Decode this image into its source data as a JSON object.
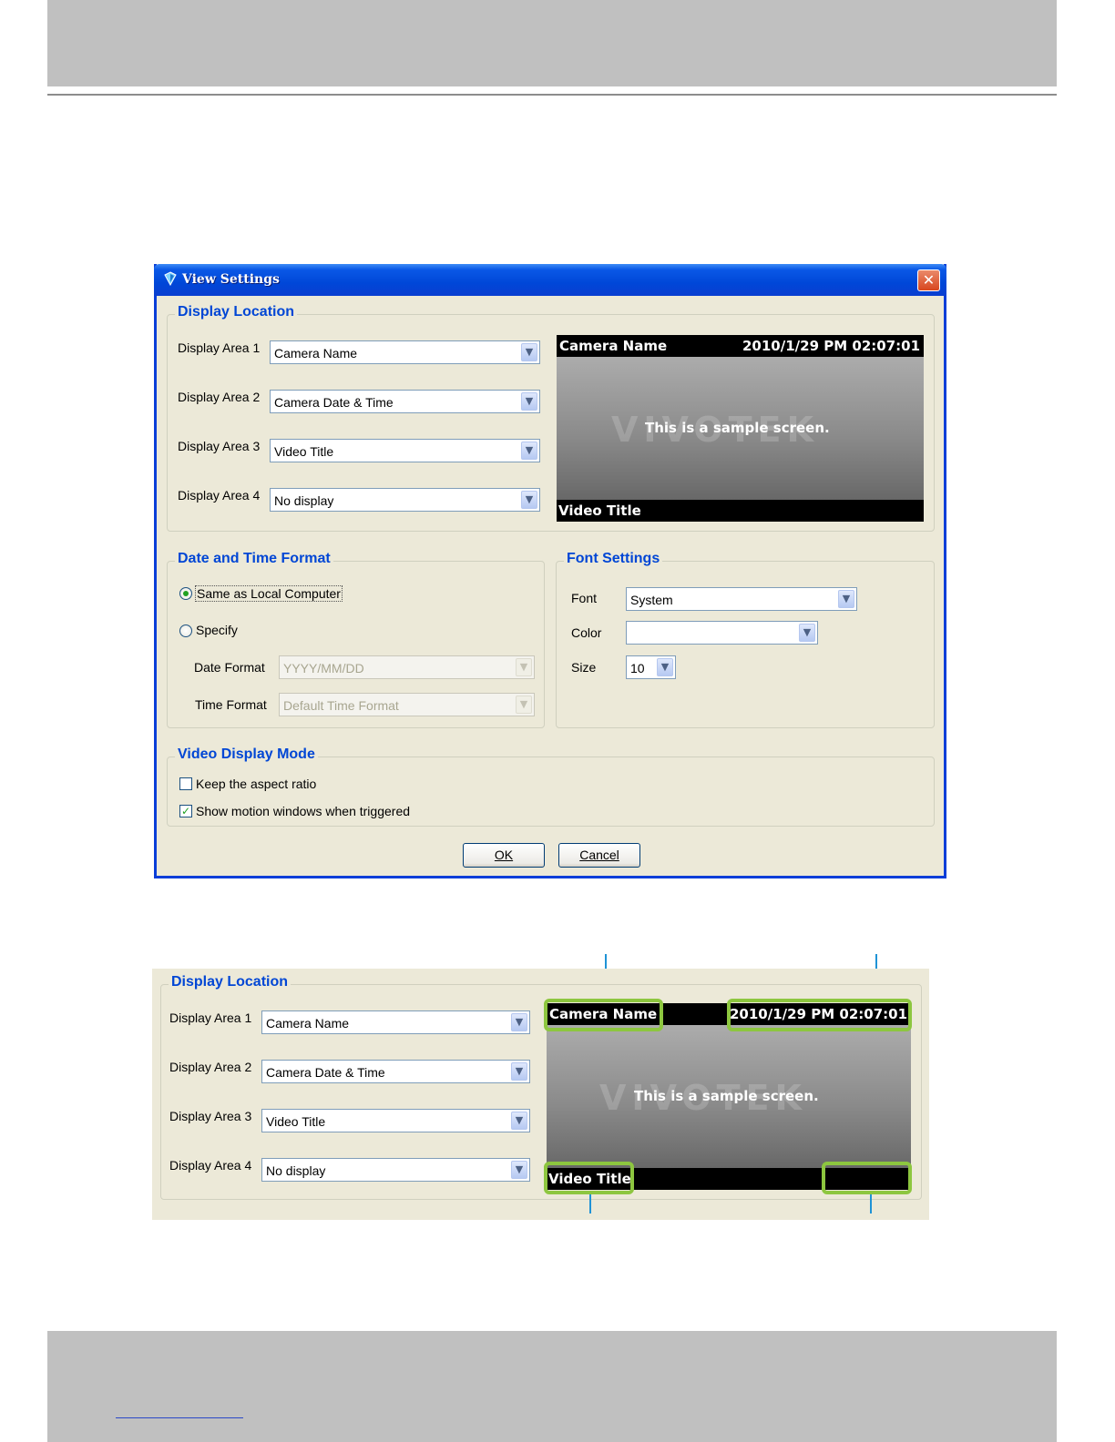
{
  "dialog": {
    "title": "View Settings",
    "close_glyph": "✕",
    "display_location": {
      "title": "Display Location",
      "areas": [
        {
          "label": "Display Area 1",
          "value": "Camera Name"
        },
        {
          "label": "Display Area 2",
          "value": "Camera Date & Time"
        },
        {
          "label": "Display Area 3",
          "value": "Video Title"
        },
        {
          "label": "Display Area 4",
          "value": "No display"
        }
      ],
      "preview": {
        "camera_name": "Camera Name",
        "datetime": "2010/1/29 PM 02:07:01",
        "sample_text": "This is a sample screen.",
        "logo": "VIVOTEK",
        "video_title": "Video Title"
      }
    },
    "date_time_format": {
      "title": "Date and Time Format",
      "option_local": "Same as Local Computer",
      "option_specify": "Specify",
      "date_format_label": "Date Format",
      "date_format_value": "YYYY/MM/DD",
      "time_format_label": "Time Format",
      "time_format_value": "Default Time Format"
    },
    "font_settings": {
      "title": "Font Settings",
      "font_label": "Font",
      "font_value": "System",
      "color_label": "Color",
      "color_value": "",
      "size_label": "Size",
      "size_value": "10"
    },
    "video_display_mode": {
      "title": "Video Display Mode",
      "keep_aspect": "Keep the aspect ratio",
      "keep_aspect_checked": false,
      "show_motion": "Show motion windows when triggered",
      "show_motion_checked": true
    },
    "ok_label": "OK",
    "cancel_label": "Cancel"
  },
  "detail_panel": {
    "title": "Display Location",
    "areas": [
      {
        "label": "Display Area 1",
        "value": "Camera Name"
      },
      {
        "label": "Display Area 2",
        "value": "Camera Date & Time"
      },
      {
        "label": "Display Area 3",
        "value": "Video Title"
      },
      {
        "label": "Display Area 4",
        "value": "No display"
      }
    ],
    "preview": {
      "camera_name": "Camera Name",
      "datetime": "2010/1/29 PM 02:07:01",
      "sample_text": "This is a sample screen.",
      "logo": "VIVOTEK",
      "video_title": "Video Title"
    }
  },
  "colors": {
    "highlight": "#8dc63f",
    "callout": "#1f93d6",
    "group_title": "#0046d5"
  },
  "icons": {
    "combo_arrow": "▼",
    "check": "✓"
  }
}
